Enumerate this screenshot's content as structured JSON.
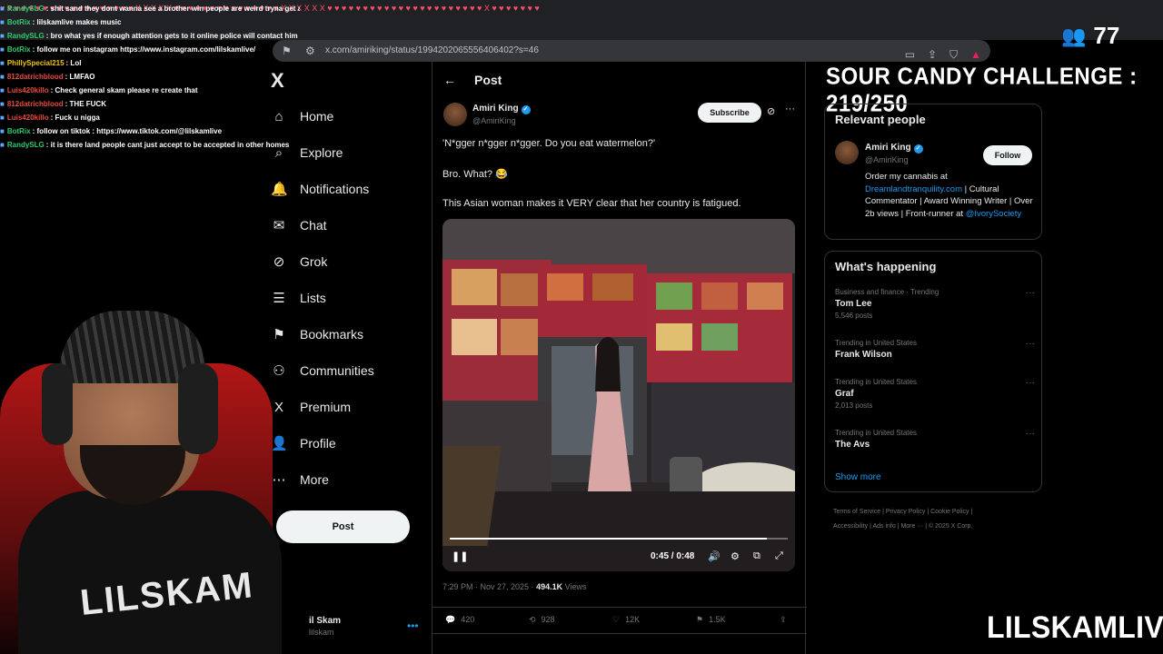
{
  "emote_strip": "♥ ♥ ♥ ♥ ♥ ♥ ♥ ♥ ♥ ♥ ♥ ♥ ♥ ♥ ♥ ♥ ♥ ♥ ♥ X X X X X ♥ ♥ ♥ ♥ ♥ ♥ ♥ ♥ ♥ ♥ ♥ ♥ ♥ ♥ ♥ X X X X X X ♥ ♥ ♥ ♥ ♥ ♥ ♥ ♥ ♥ ♥ ♥ ♥ ♥ ♥ ♥ ♥ ♥ ♥ ♥ ♥ ♥ ♥ X ♥ ♥ ♥ ♥ ♥ ♥ ♥",
  "browser": {
    "url": "x.com/amiriking/status/1994202065556406402?s=46"
  },
  "chat": [
    {
      "user": "RandySLG",
      "color": "#2ecc71",
      "message": ": shit sand they dont wanna see a brother win people are weird tryna get a case going on him"
    },
    {
      "user": "BotRix",
      "color": "#2ecc71",
      "message": ": lilskamlive makes music"
    },
    {
      "user": "RandySLG",
      "color": "#2ecc71",
      "message": ": bro what yes if enough attention gets to it online police will contact him"
    },
    {
      "user": "BotRix",
      "color": "#2ecc71",
      "message": ": follow me on instagram https://www.instagram.com/lilskamlive/"
    },
    {
      "user": "PhillySpecial215",
      "color": "#f1c40f",
      "message": ": Lol"
    },
    {
      "user": "812datrichblood",
      "color": "#e74c3c",
      "message": ": LMFAO"
    },
    {
      "user": "Luis420killo",
      "color": "#e74c3c",
      "message": ": Check general skam please re create that"
    },
    {
      "user": "812datrichblood",
      "color": "#e74c3c",
      "message": ": THE FUCK"
    },
    {
      "user": "Luis420killo",
      "color": "#e74c3c",
      "message": ": Fuck u nigga"
    },
    {
      "user": "BotRix",
      "color": "#2ecc71",
      "message": ": follow on tiktok : https://www.tiktok.com/@lilskamlive"
    },
    {
      "user": "RandySLG",
      "color": "#2ecc71",
      "message": ": it is there land people cant just accept to be accepted in other homes"
    }
  ],
  "sidebar": {
    "logo": "X",
    "items": [
      {
        "label": "Home",
        "icon": "⌂"
      },
      {
        "label": "Explore",
        "icon": "⌕"
      },
      {
        "label": "Notifications",
        "icon": "🔔"
      },
      {
        "label": "Chat",
        "icon": "✉"
      },
      {
        "label": "Grok",
        "icon": "⊘"
      },
      {
        "label": "Lists",
        "icon": "☰"
      },
      {
        "label": "Bookmarks",
        "icon": "⚑"
      },
      {
        "label": "Communities",
        "icon": "⚇"
      },
      {
        "label": "Premium",
        "icon": "X"
      },
      {
        "label": "Profile",
        "icon": "👤"
      },
      {
        "label": "More",
        "icon": "⋯"
      }
    ],
    "post_button": "Post",
    "account_name": "il Skam",
    "account_handle": "lilskam"
  },
  "post": {
    "header": "Post",
    "author": "Amiri King",
    "handle": "@AmiriKing",
    "subscribe": "Subscribe",
    "text1": "'N*gger n*gger n*gger. Do you eat watermelon?'",
    "text2": "Bro. What? 😂",
    "text3": "This Asian woman makes it VERY clear that her country is fatigued.",
    "video_time": "0:45 / 0:48",
    "progress": 0.9375,
    "timestamp": "7:29 PM · Nov 27, 2025 ·",
    "views_count": "494.1K",
    "views_label": "Views",
    "replies": "420",
    "reposts": "928",
    "likes": "12K",
    "bookmarks": "1.5K"
  },
  "right": {
    "challenge": "SOUR CANDY CHALLENGE : 219/250",
    "relevant_title": "Relevant people",
    "rp_name": "Amiri King",
    "rp_handle": "@AmiriKing",
    "follow": "Follow",
    "bio_text1": "Order my cannabis at",
    "bio_link1": "Dreamlandtranquility.com",
    "bio_text2": "| Cultural Commentator | Award Winning Writer | Over 2b views | Front-runner at",
    "bio_link2": "@IvorySociety",
    "happening_title": "What's happening",
    "trends": [
      {
        "context": "Business and finance · Trending",
        "name": "Tom Lee",
        "count": "5,546 posts"
      },
      {
        "context": "Trending in United States",
        "name": "Frank Wilson",
        "count": ""
      },
      {
        "context": "Trending in United States",
        "name": "Graf",
        "count": "2,013 posts"
      },
      {
        "context": "Trending in United States",
        "name": "The Avs",
        "count": ""
      }
    ],
    "show_more": "Show more",
    "footer_line1": "Terms of Service  |  Privacy Policy  |  Cookie Policy  |",
    "footer_line2": "Accessibility  |  Ads info  |  More ···  |  © 2025 X Corp."
  },
  "overlay": {
    "viewers": "77",
    "watermark": "LILSKAMLIVE",
    "hoodie_text": "LILSKAM"
  }
}
